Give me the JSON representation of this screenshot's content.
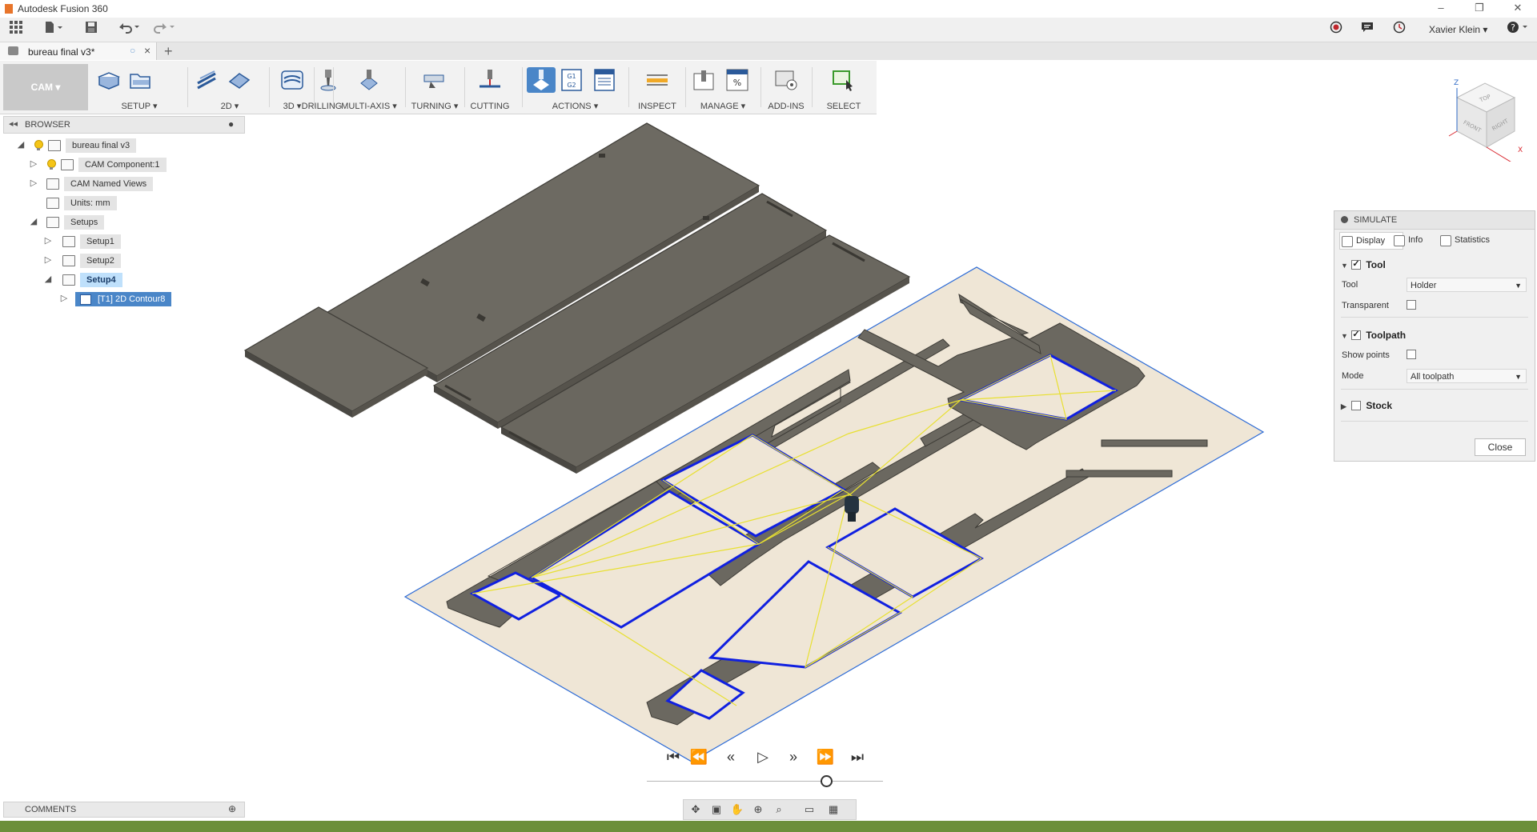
{
  "window": {
    "title": "Autodesk Fusion 360",
    "minimize": "–",
    "restore": "❐",
    "close": "✕"
  },
  "qat": {
    "user": "Xavier Klein",
    "help": "?"
  },
  "document_tab": {
    "label": "bureau final v3*",
    "close": "×",
    "new_tab": "+"
  },
  "toolbar": {
    "workspace": "CAM ▾",
    "groups": [
      {
        "label": "SETUP ▾"
      },
      {
        "label": "2D ▾"
      },
      {
        "label": "3D ▾"
      },
      {
        "label": "DRILLING"
      },
      {
        "label": "MULTI-AXIS ▾"
      },
      {
        "label": "TURNING ▾"
      },
      {
        "label": "CUTTING"
      },
      {
        "label": "ACTIONS ▾"
      },
      {
        "label": "INSPECT"
      },
      {
        "label": "MANAGE ▾"
      },
      {
        "label": "ADD-INS"
      },
      {
        "label": "SELECT"
      }
    ]
  },
  "browser": {
    "title": "BROWSER",
    "items": [
      {
        "label": "bureau final v3"
      },
      {
        "label": "CAM Component:1"
      },
      {
        "label": "CAM Named Views"
      },
      {
        "label": "Units: mm"
      },
      {
        "label": "Setups"
      },
      {
        "label": "Setup1"
      },
      {
        "label": "Setup2"
      },
      {
        "label": "Setup4"
      },
      {
        "label": "[T1] 2D Contour8"
      }
    ]
  },
  "comments": {
    "title": "COMMENTS"
  },
  "viewcube": {
    "top": "TOP",
    "front": "FRONT",
    "right": "RIGHT",
    "z": "Z",
    "x": "X"
  },
  "simulate": {
    "title": "SIMULATE",
    "tabs": [
      {
        "label": "Display"
      },
      {
        "label": "Info"
      },
      {
        "label": "Statistics"
      }
    ],
    "tool_section": "Tool",
    "tool_label": "Tool",
    "tool_value": "Holder",
    "transparent_label": "Transparent",
    "toolpath_section": "Toolpath",
    "show_points_label": "Show points",
    "mode_label": "Mode",
    "mode_value": "All toolpath",
    "stock_section": "Stock",
    "close_label": "Close"
  },
  "colors": {
    "panel_wood": "#6b6860",
    "stock": "#efe6d6",
    "toolpath_blue": "#1020e0",
    "rapid_yellow": "#e8e030",
    "status_green": "#6c8f3a"
  }
}
